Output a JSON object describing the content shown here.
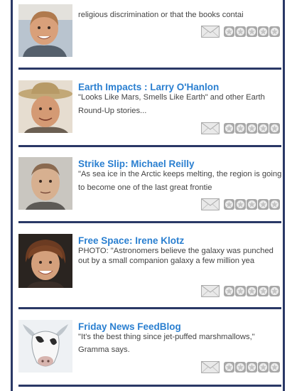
{
  "items": [
    {
      "title": "",
      "excerpt": "religious discrimination or that the books contai",
      "rating": 0
    },
    {
      "title": "Earth Impacts : Larry O'Hanlon",
      "excerpt": "\"Looks Like Mars, Smells Like Earth\" and other Earth Round-Up stories...",
      "rating": 0
    },
    {
      "title": "Strike Slip: Michael Reilly",
      "excerpt": "\"As sea ice in the Arctic keeps melting, the region is going to become one of the last great frontie",
      "rating": 0
    },
    {
      "title": "Free Space: Irene Klotz",
      "excerpt": "PHOTO: \"Astronomers believe the galaxy was punched out by a small companion galaxy a few million yea",
      "rating": 0
    },
    {
      "title": "Friday News FeedBlog",
      "excerpt": "\"It's the best thing since jet-puffed marshmallows,\" Gramma says.",
      "rating": 0
    }
  ],
  "icons": {
    "share": "envelope-icon",
    "rating": "star-icon"
  },
  "colors": {
    "title": "#2a7fd0",
    "divider": "#2a3866",
    "text": "#444444"
  }
}
